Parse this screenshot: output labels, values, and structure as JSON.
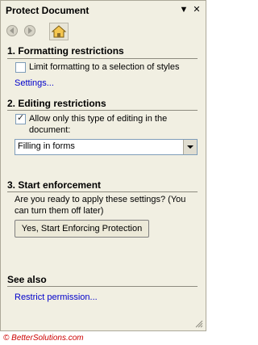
{
  "pane": {
    "title": "Protect Document",
    "dropdown_glyph": "▼",
    "close_glyph": "✕"
  },
  "toolbar": {
    "back_icon": "back-icon",
    "forward_icon": "forward-icon",
    "home_icon": "home-icon"
  },
  "formatting": {
    "heading": "1. Formatting restrictions",
    "checkbox_label": "Limit formatting to a selection of styles",
    "checked": false,
    "settings_link": "Settings..."
  },
  "editing": {
    "heading": "2. Editing restrictions",
    "checkbox_label_line1": "Allow only this type of editing in the",
    "checkbox_label_line2": "document:",
    "checked": true,
    "select_value": "Filling in forms"
  },
  "enforcement": {
    "heading": "3. Start enforcement",
    "question_line1": "Are you ready to apply these settings? (You",
    "question_line2": "can turn them off later)",
    "button_label": "Yes, Start Enforcing Protection"
  },
  "see_also": {
    "heading": "See also",
    "link": "Restrict permission..."
  },
  "footer": "© BetterSolutions.com"
}
